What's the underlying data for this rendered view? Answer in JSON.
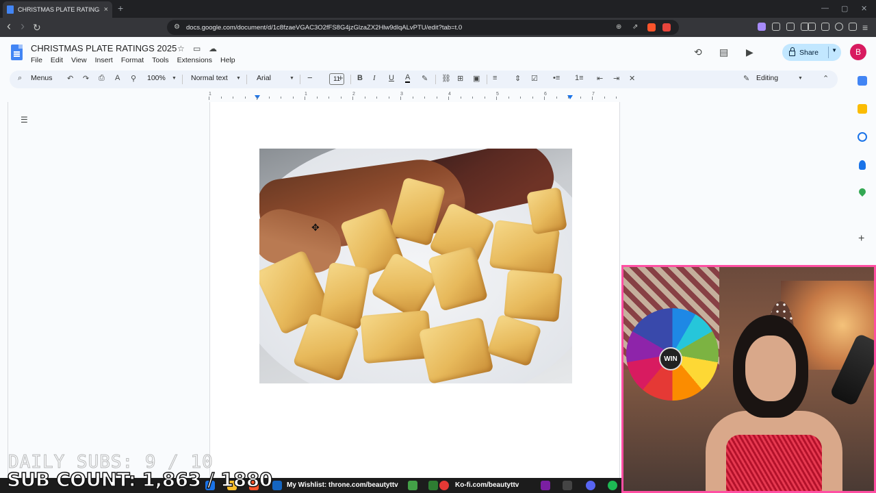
{
  "browser": {
    "tab_title": "CHRISTMAS PLATE RATINGS 20...",
    "tab_close": "×",
    "new_tab": "+",
    "url": "docs.google.com/document/d/1c8fzaeVGAC3O2fFS8G4jzGlzaZX2Hlw9dlqALvPTU/edit?tab=t.0",
    "back": "‹",
    "forward": "›",
    "reload": "↻",
    "minimize": "—",
    "maximize": "▢",
    "close": "✕"
  },
  "docs": {
    "title": "CHRISTMAS PLATE RATINGS 2025",
    "menu": [
      "File",
      "Edit",
      "View",
      "Insert",
      "Format",
      "Tools",
      "Extensions",
      "Help"
    ],
    "share_label": "Share",
    "avatar_letter": "B",
    "accent": "#c2e7ff"
  },
  "toolbar": {
    "search_label": "Menus",
    "zoom": "100%",
    "style": "Normal text",
    "font": "Arial",
    "font_size": "11",
    "mode": "Editing"
  },
  "ruler": {
    "numbers": [
      "1",
      "1",
      "2",
      "3",
      "4",
      "5",
      "6",
      "7"
    ]
  },
  "stream": {
    "daily_subs": "DAILY SUBS: 9 / 10",
    "sub_count": "SUB COUNT: 1,863 / 1880",
    "wheel_label": "WIN",
    "border_color": "#ff4fa3"
  },
  "taskbar": {
    "wishlist": "My Wishlist: throne.com/beautyttv",
    "kofi": "Ko-fi.com/beautyttv"
  }
}
